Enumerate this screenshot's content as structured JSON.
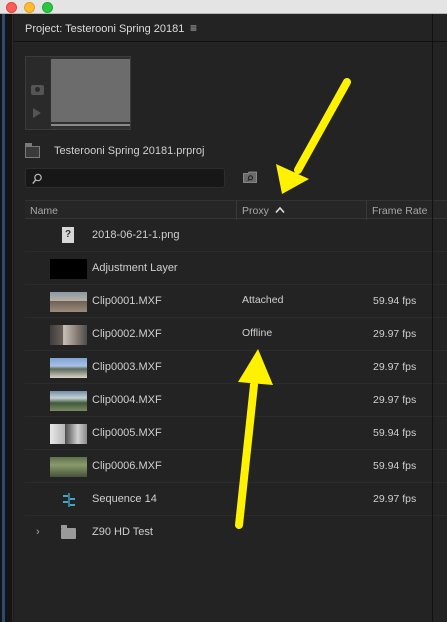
{
  "window": {
    "project_tab": "Project: Testerooni Spring 20181",
    "menu_glyph": "≡"
  },
  "project": {
    "file_name": "Testerooni Spring 20181.prproj"
  },
  "search": {
    "value": "",
    "placeholder": ""
  },
  "columns": {
    "name": "Name",
    "proxy": "Proxy",
    "frame_rate": "Frame Rate"
  },
  "items": [
    {
      "name": "2018-06-21-1.png",
      "proxy": "",
      "frame_rate": "",
      "kind": "image-file-icon"
    },
    {
      "name": "Adjustment Layer",
      "proxy": "",
      "frame_rate": "",
      "kind": "adjustment-layer"
    },
    {
      "name": "Clip0001.MXF",
      "proxy": "Attached",
      "frame_rate": "59.94 fps",
      "kind": "clip"
    },
    {
      "name": "Clip0002.MXF",
      "proxy": "Offline",
      "frame_rate": "29.97 fps",
      "kind": "clip"
    },
    {
      "name": "Clip0003.MXF",
      "proxy": "",
      "frame_rate": "29.97 fps",
      "kind": "clip"
    },
    {
      "name": "Clip0004.MXF",
      "proxy": "",
      "frame_rate": "29.97 fps",
      "kind": "clip"
    },
    {
      "name": "Clip0005.MXF",
      "proxy": "",
      "frame_rate": "59.94 fps",
      "kind": "clip"
    },
    {
      "name": "Clip0006.MXF",
      "proxy": "",
      "frame_rate": "59.94 fps",
      "kind": "clip"
    },
    {
      "name": "Sequence 14",
      "proxy": "",
      "frame_rate": "29.97 fps",
      "kind": "sequence-icon"
    },
    {
      "name": "Z90 HD Test",
      "proxy": "",
      "frame_rate": "",
      "kind": "folder-icon"
    }
  ],
  "colors": {
    "annotation_arrow": "#fff200",
    "panel_bg": "#232323"
  }
}
